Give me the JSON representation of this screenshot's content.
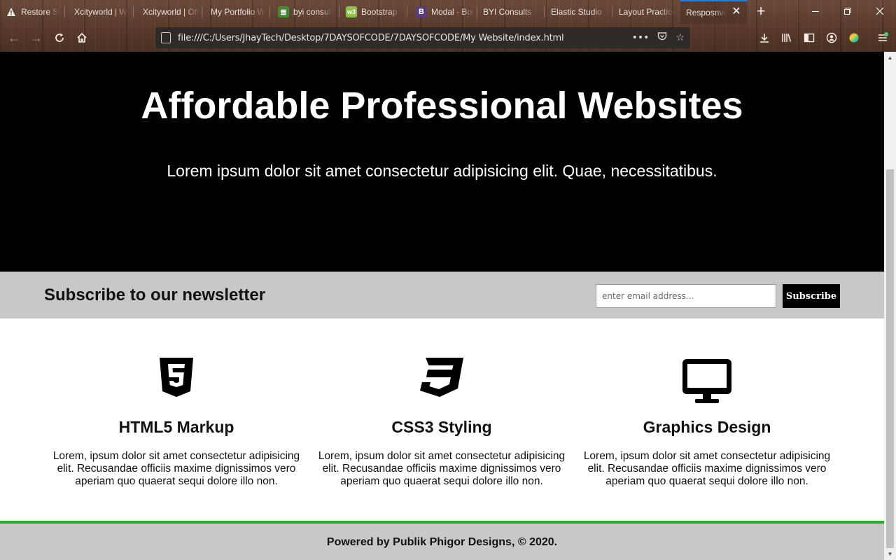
{
  "browser": {
    "tabs": [
      {
        "title": "Restore Session",
        "favicon": "warning-icon"
      },
      {
        "title": "Xcityworld | Web",
        "favicon": ""
      },
      {
        "title": "Xcityworld | Official",
        "favicon": ""
      },
      {
        "title": "My Portfolio Website",
        "favicon": ""
      },
      {
        "title": "byi consult",
        "favicon": "mdn-icon"
      },
      {
        "title": "Bootstrap",
        "favicon": "w3schools-icon"
      },
      {
        "title": "Modal · Bootstrap",
        "favicon": "bootstrap-icon"
      },
      {
        "title": "BYI Consults",
        "favicon": ""
      },
      {
        "title": "Elastic Studio",
        "favicon": ""
      },
      {
        "title": "Layout Practice",
        "favicon": ""
      },
      {
        "title": "Resposnvie Website",
        "favicon": ""
      }
    ],
    "url": "file:///C:/Users/JhayTech/Desktop/7DAYSOFCODE/7DAYSOFCODE/My Website/index.html"
  },
  "hero": {
    "title": "Affordable Professional Websites",
    "subtitle": "Lorem ipsum dolor sit amet consectetur adipisicing elit. Quae, necessitatibus."
  },
  "newsletter": {
    "heading": "Subscribe to our newsletter",
    "email_placeholder": "enter email address...",
    "button_label": "Subscribe"
  },
  "features": [
    {
      "icon": "html5-icon",
      "title": "HTML5 Markup",
      "text": "Lorem, ipsum dolor sit amet consectetur adipisicing elit. Recusandae officiis maxime dignissimos vero aperiam quo quaerat sequi dolore illo non."
    },
    {
      "icon": "css3-icon",
      "title": "CSS3 Styling",
      "text": "Lorem, ipsum dolor sit amet consectetur adipisicing elit. Recusandae officiis maxime dignissimos vero aperiam quo quaerat sequi dolore illo non."
    },
    {
      "icon": "desktop-monitor-icon",
      "title": "Graphics Design",
      "text": "Lorem, ipsum dolor sit amet consectetur adipisicing elit. Recusandae officiis maxime dignissimos vero aperiam quo quaerat sequi dolore illo non."
    }
  ],
  "footer": {
    "text": "Powered by Publik Phigor Designs, © 2020."
  },
  "colors": {
    "hero_bg": "#000000",
    "band_bg": "#c8c8c8",
    "footer_accent": "#22b322"
  }
}
